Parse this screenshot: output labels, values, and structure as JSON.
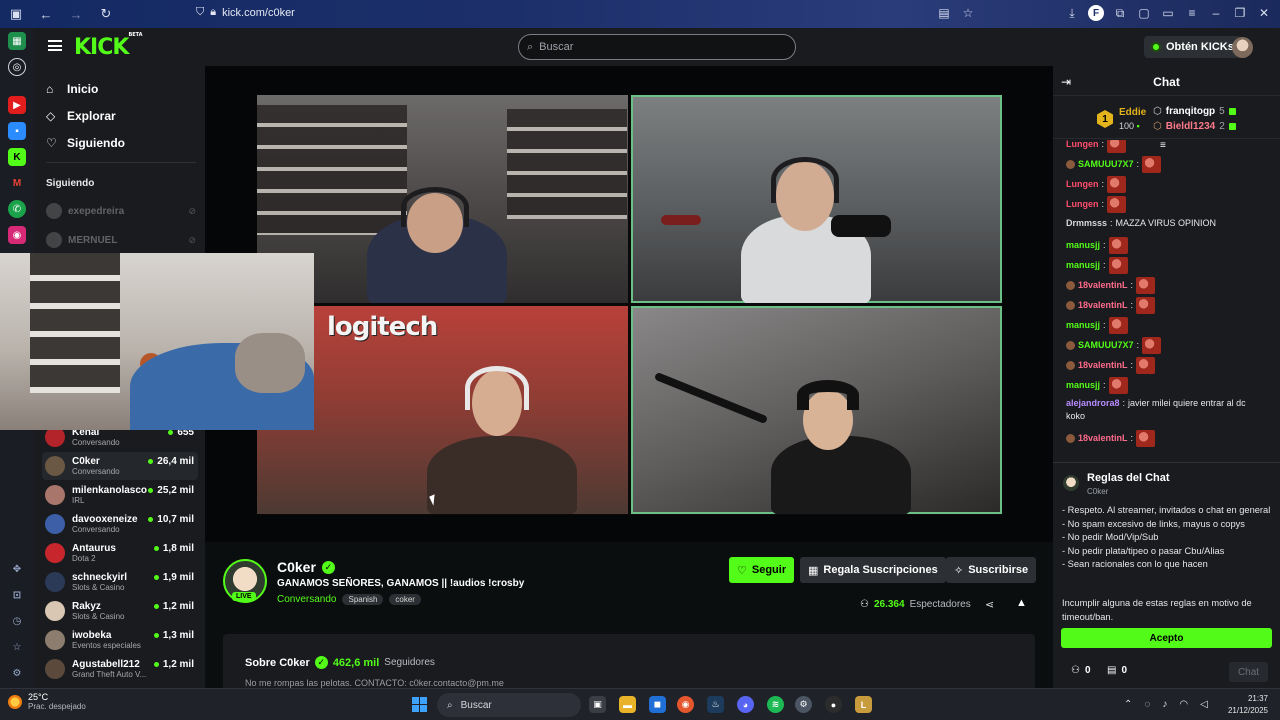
{
  "browser": {
    "url": "kick.com/c0ker"
  },
  "topbar": {
    "logo": "KICK",
    "logo_badge": "BETA",
    "search_placeholder": "Buscar",
    "kicks_button": "Obtén KICKs"
  },
  "sidebar": {
    "nav": [
      {
        "label": "Inicio",
        "icon": "home-icon"
      },
      {
        "label": "Explorar",
        "icon": "compass-icon"
      },
      {
        "label": "Siguiendo",
        "icon": "heart-icon"
      }
    ],
    "following_heading": "Siguiendo",
    "following": [
      {
        "name": "exepedreira"
      },
      {
        "name": "MERNUEL"
      }
    ],
    "recommended": [
      {
        "name": "Kenai",
        "category": "Conversando",
        "viewers": "655"
      },
      {
        "name": "C0ker",
        "category": "Conversando",
        "viewers": "26,4 mil",
        "active": true
      },
      {
        "name": "milenkanolasco",
        "category": "IRL",
        "viewers": "25,2 mil"
      },
      {
        "name": "davooxeneize",
        "category": "Conversando",
        "viewers": "10,7 mil"
      },
      {
        "name": "Antaurus",
        "category": "Dota 2",
        "viewers": "1,8 mil"
      },
      {
        "name": "schneckyirl",
        "category": "Slots & Casino",
        "viewers": "1,9 mil"
      },
      {
        "name": "Rakyz",
        "category": "Slots & Casino",
        "viewers": "1,2 mil"
      },
      {
        "name": "iwobeka",
        "category": "Eventos especiales",
        "viewers": "1,3 mil"
      },
      {
        "name": "Agustabell212",
        "category": "Grand Theft Auto V...",
        "viewers": "1,2 mil"
      }
    ]
  },
  "video": {
    "sign_text": "logitech"
  },
  "stream": {
    "channel_name": "C0ker",
    "live_label": "LIVE",
    "title": "GANAMOS SEÑORES, GANAMOS || !audios !crosby",
    "category": "Conversando",
    "tags": [
      "Spanish",
      "coker"
    ],
    "follow_label": "Seguir",
    "gift_label": "Regala Suscripciones",
    "subscribe_label": "Suscribirse",
    "viewers_count": "26.364",
    "viewers_label": "Espectadores"
  },
  "about": {
    "title": "Sobre C0ker",
    "followers_count": "462,6 mil",
    "followers_label": "Seguidores",
    "description": "No me rompas las pelotas. CONTACTO: c0ker.contacto@pm.me"
  },
  "chat": {
    "title": "Chat",
    "leaderboard": {
      "rank": "1",
      "top_name": "Eddie",
      "top_count": "100",
      "entries": [
        {
          "name": "franqitogp",
          "count": "5"
        },
        {
          "name": "Bieldl1234",
          "count": "2"
        }
      ]
    },
    "messages": [
      {
        "user": "Lungen",
        "color": "#ff4d6d",
        "text": "",
        "emote": true,
        "badge": false
      },
      {
        "user": "SAMUUU7X7",
        "color": "#53fc18",
        "text": "",
        "emote": true,
        "badge": true
      },
      {
        "user": "Lungen",
        "color": "#ff4d6d",
        "text": "",
        "emote": true,
        "badge": false
      },
      {
        "user": "Lungen",
        "color": "#ff4d6d",
        "text": "",
        "emote": true,
        "badge": false
      },
      {
        "user": "Drmmsss",
        "color": "#d8d8d8",
        "text": "MAZZA VIRUS OPINION",
        "emote": false,
        "badge": false
      },
      {
        "user": "manusjj",
        "color": "#53fc18",
        "text": "",
        "emote": true,
        "badge": false
      },
      {
        "user": "manusjj",
        "color": "#53fc18",
        "text": "",
        "emote": true,
        "badge": false
      },
      {
        "user": "18valentinL",
        "color": "#ff6b8b",
        "text": "",
        "emote": true,
        "badge": true
      },
      {
        "user": "18valentinL",
        "color": "#ff6b8b",
        "text": "",
        "emote": true,
        "badge": true
      },
      {
        "user": "manusjj",
        "color": "#53fc18",
        "text": "",
        "emote": true,
        "badge": false
      },
      {
        "user": "SAMUUU7X7",
        "color": "#53fc18",
        "text": "",
        "emote": true,
        "badge": true
      },
      {
        "user": "18valentinL",
        "color": "#ff6b8b",
        "text": "",
        "emote": true,
        "badge": true
      },
      {
        "user": "manusjj",
        "color": "#53fc18",
        "text": "",
        "emote": true,
        "badge": false
      },
      {
        "user": "alejandrora8",
        "color": "#b88cff",
        "text": "javier milei quiere entrar al dc",
        "emote": false,
        "badge": false
      },
      {
        "user": "",
        "color": "#e8e8e8",
        "text": "koko",
        "emote": false,
        "badge": false
      },
      {
        "user": "18valentinL",
        "color": "#ff6b8b",
        "text": "",
        "emote": true,
        "badge": true
      }
    ],
    "rules": {
      "title": "Reglas del Chat",
      "author": "C0ker",
      "lines": [
        "- Respeto. Al streamer, invitados o chat en general",
        "- No spam excesivo de links, mayus o copys",
        "- No pedir Mod/Vip/Sub",
        "- No pedir plata/tipeo o pasar Cbu/Alias",
        "- Sean racionales con lo que hacen"
      ],
      "footer": "Incumplir alguna de estas reglas en motivo de timeout/ban.",
      "accept_label": "Acepto"
    },
    "bottom": {
      "points": "0",
      "gifts": "0",
      "send_label": "Chat"
    }
  },
  "taskbar": {
    "weather_temp": "25°C",
    "weather_desc": "Prac. despejado",
    "search_placeholder": "Buscar",
    "time": "21:37",
    "date": "21/12/2025"
  },
  "colors": {
    "kick_green": "#53fc18",
    "panel_bg": "#191b1f",
    "page_bg": "#0b0e0f"
  }
}
